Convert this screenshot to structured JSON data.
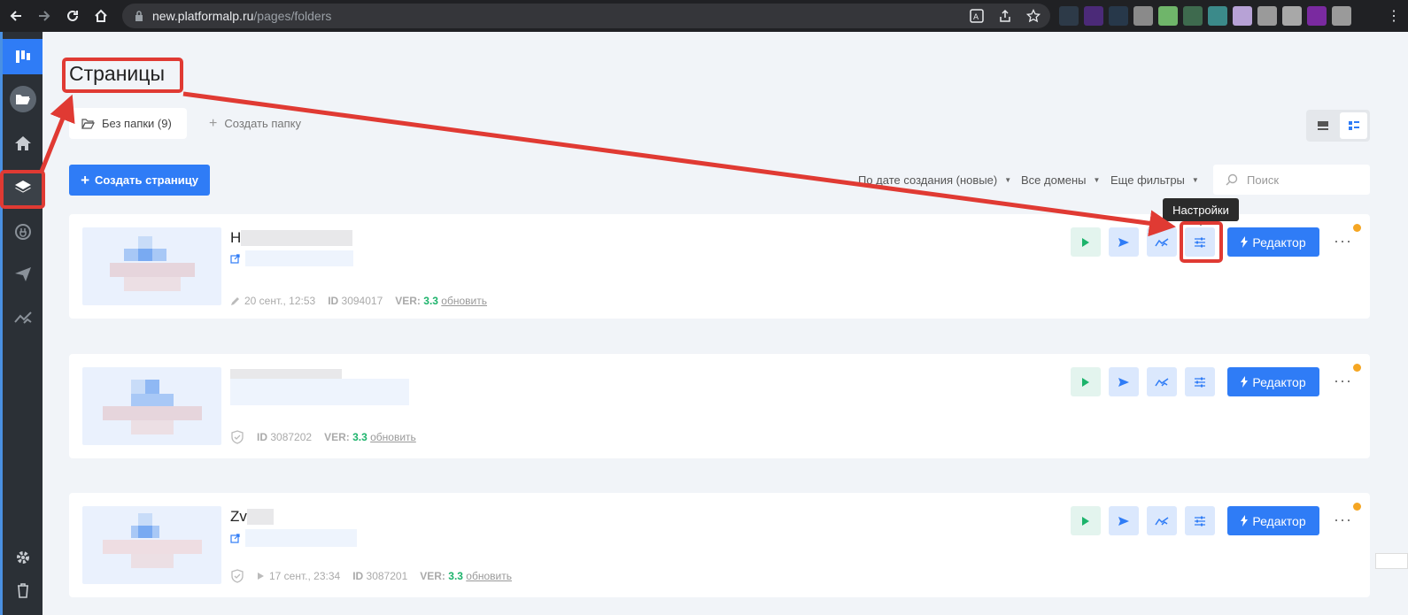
{
  "browser": {
    "url_host": "new.platformalp.ru",
    "url_path": "/pages/folders",
    "extension_colors": [
      "#2d3a48",
      "#4b2a78",
      "#27384a",
      "#8a8a8a",
      "#6fb56a",
      "#3e6a4e",
      "#3b8a8a",
      "#b7a2d6",
      "#9a9a9a",
      "#a8a8a8",
      "#7a2aa0",
      "#9a9a9a"
    ]
  },
  "main": {
    "title": "Страницы",
    "folder_tab": "Без папки (9)",
    "create_folder": "Создать папку",
    "create_page": "Создать страницу",
    "filters": {
      "sort": "По дате создания (новые)",
      "domains": "Все домены",
      "more": "Еще фильтры"
    },
    "search_placeholder": "Поиск"
  },
  "tooltip": "Настройки",
  "cards": [
    {
      "title_prefix": "Н",
      "edited": "20 сент., 12:53",
      "id_label": "ID",
      "id": "3094017",
      "ver_label": "VER:",
      "ver": "3.3",
      "update": "обновить",
      "editor": "Редактор"
    },
    {
      "title_prefix": "",
      "id_label": "ID",
      "id": "3087202",
      "ver_label": "VER:",
      "ver": "3.3",
      "update": "обновить",
      "editor": "Редактор"
    },
    {
      "title_prefix": "Zv",
      "published": "17 сент., 23:34",
      "id_label": "ID",
      "id": "3087201",
      "ver_label": "VER:",
      "ver": "3.3",
      "update": "обновить",
      "editor": "Редактор"
    }
  ],
  "colors": {
    "accent": "#2f7cf6",
    "annotation": "#e03a33",
    "ver_green": "#1cb36b",
    "status_dot": "#f5a623"
  }
}
